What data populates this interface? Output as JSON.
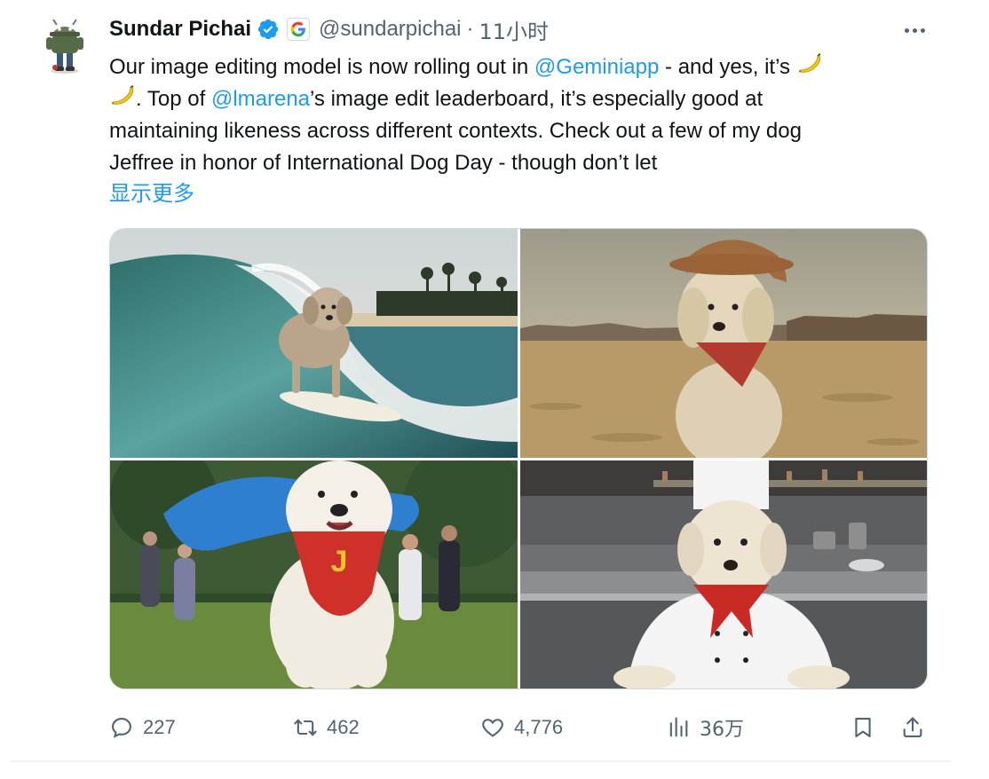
{
  "tweet": {
    "author_name": "Sundar Pichai",
    "handle": "@sundarpichai",
    "separator": "·",
    "time": "11小时",
    "text_lines": [
      [
        "Our image editing model is now rolling out in ",
        "@Geminiapp",
        " - and yes, it’s "
      ],
      [
        ". Top of ",
        "@lmarena",
        "’s image edit leaderboard, it’s especially good at"
      ],
      [
        "maintaining likeness across different contexts. Check out a few of my dog"
      ],
      [
        "Jeffree in honor of International Dog Day - though don’t let"
      ]
    ],
    "show_more": "显示更多",
    "images": [
      {
        "name": "dog-surfing-photo"
      },
      {
        "name": "dog-cowboy-desert-photo"
      },
      {
        "name": "dog-superhero-cape-photo"
      },
      {
        "name": "dog-chef-kitchen-photo"
      }
    ],
    "stats": {
      "replies": "227",
      "retweets": "462",
      "likes": "4,776",
      "views": "36万"
    }
  },
  "icons": {
    "verified": "verified-badge-icon",
    "affiliate": "google-logo-icon",
    "more": "more-options-icon",
    "reply": "reply-icon",
    "retweet": "retweet-icon",
    "like": "heart-icon",
    "views": "views-bar-chart-icon",
    "bookmark": "bookmark-icon",
    "share": "share-icon",
    "emoji": "banana-emoji-icon"
  },
  "colors": {
    "link": "#1d9bf0",
    "verified": "#1d9bf0",
    "muted": "#536471",
    "text": "#0f1419"
  }
}
